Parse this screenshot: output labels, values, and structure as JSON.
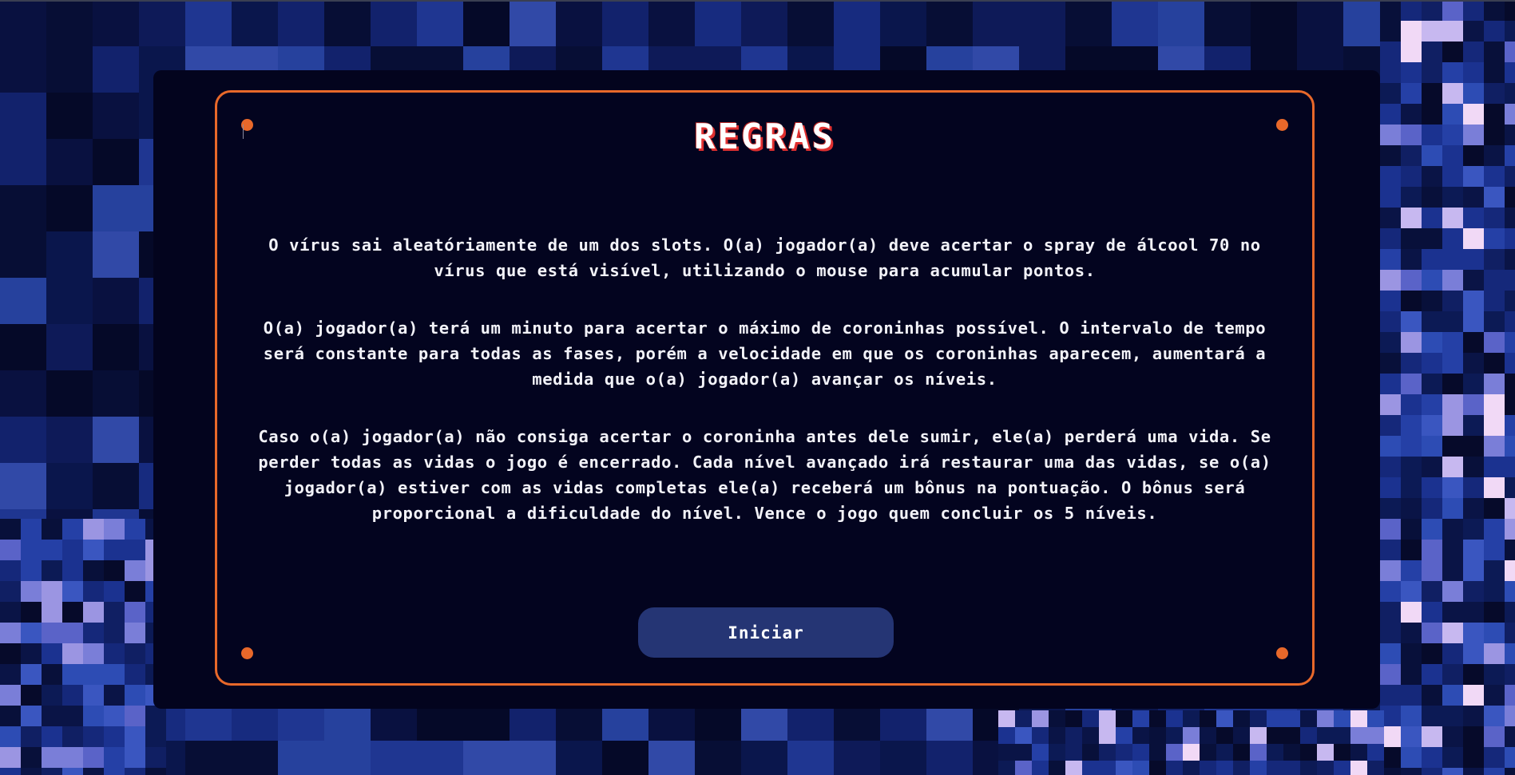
{
  "rules": {
    "title": "REGRAS",
    "paragraphs": [
      "O vírus sai aleatóriamente de um dos slots. O(a) jogador(a) deve acertar o spray de álcool 70 no vírus que está visível, utilizando o mouse para acumular pontos.",
      "O(a) jogador(a) terá um minuto para acertar o máximo de coroninhas possível. O intervalo de tempo será constante para todas as fases, porém a velocidade em que os coroninhas aparecem, aumentará a medida que o(a) jogador(a) avançar os níveis.",
      "Caso o(a) jogador(a) não consiga acertar o coroninha antes dele sumir, ele(a) perderá uma vida. Se perder todas as vidas o jogo é encerrado. Cada nível avançado irá restaurar uma das vidas, se o(a) jogador(a) estiver com as vidas completas ele(a) receberá um bônus na pontuação. O bônus será proporcional a dificuldade do nível. Vence o jogo quem concluir os 5 níveis."
    ],
    "start_label": "Iniciar"
  },
  "colors": {
    "accent": "#e8682a",
    "panel": "#03041f",
    "button": "#253574",
    "title_shadow": "#e03030"
  },
  "background": {
    "style": "pixelated-blue-mosaic"
  }
}
